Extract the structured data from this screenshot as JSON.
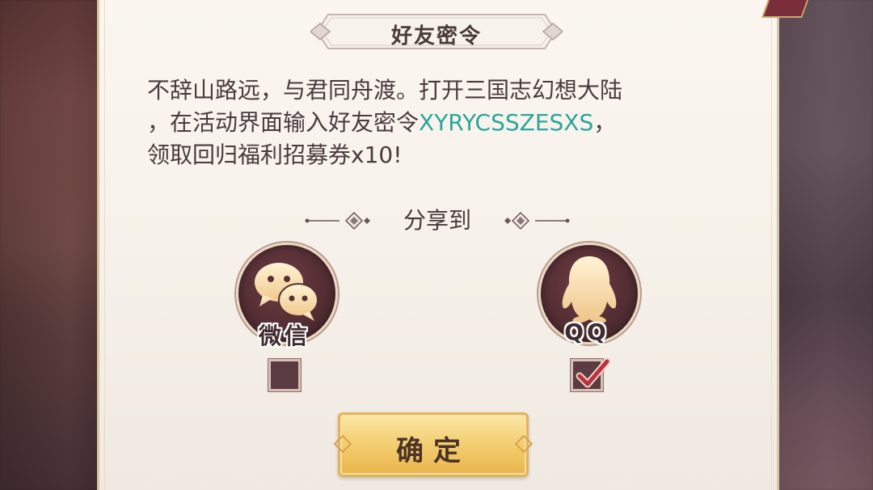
{
  "dialog": {
    "title": "好友密令",
    "message_line1": "不辞山路远，与君同舟渡。打开三国志幻想大陆",
    "message_line2_prefix": "，在活动界面输入好友密令",
    "code": "XYRYCSSZESXS",
    "message_line2_suffix": "，",
    "message_line3": "领取回归福利招募券x10!",
    "share_label": "分享到",
    "share_options": [
      {
        "name": "微信",
        "icon": "wechat-icon",
        "checked": false
      },
      {
        "name": "QQ",
        "icon": "qq-icon",
        "checked": true
      }
    ],
    "confirm_label": "确定"
  },
  "colors": {
    "panel_bg": "#f6f1ea",
    "code_text": "#2aa69a",
    "body_text": "#4a3a3e",
    "circle_bg": "#4c2a30",
    "checkbox_bg": "#5a3c42",
    "check_mark": "#c0303a",
    "button_gold": "#f2cb6c"
  }
}
